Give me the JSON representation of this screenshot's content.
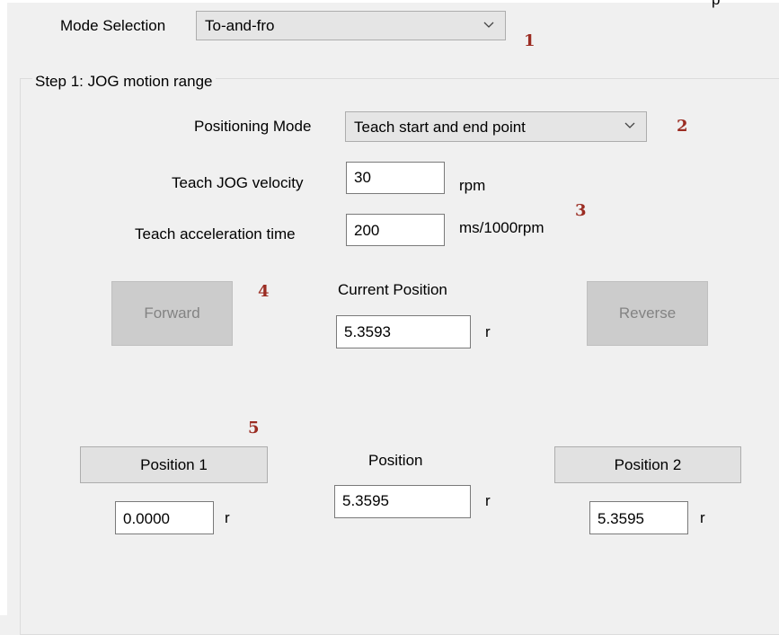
{
  "corner_text": "p",
  "mode_selection": {
    "label": "Mode Selection",
    "value": "To-and-fro"
  },
  "step1": {
    "title": "Step 1: JOG motion range",
    "positioning_mode": {
      "label": "Positioning Mode",
      "value": "Teach start and end point"
    },
    "teach_jog_velocity": {
      "label": "Teach JOG velocity",
      "value": "30",
      "unit": "rpm"
    },
    "teach_accel_time": {
      "label": "Teach acceleration time",
      "value": "200",
      "unit": "ms/1000rpm"
    },
    "forward_button": "Forward",
    "reverse_button": "Reverse",
    "current_position": {
      "label": "Current Position",
      "value": "5.3593",
      "unit": "r"
    },
    "position_1": {
      "button": "Position 1",
      "value": "0.0000",
      "unit": "r"
    },
    "position": {
      "label": "Position",
      "value": "5.3595",
      "unit": "r"
    },
    "position_2": {
      "button": "Position 2",
      "value": "5.3595",
      "unit": "r"
    }
  },
  "callouts": [
    "1",
    "2",
    "3",
    "4",
    "5"
  ],
  "colors": {
    "callout": "#9b2c22",
    "background": "#f0f0f0"
  },
  "icons": {
    "dropdown": "chevron-down-icon"
  }
}
